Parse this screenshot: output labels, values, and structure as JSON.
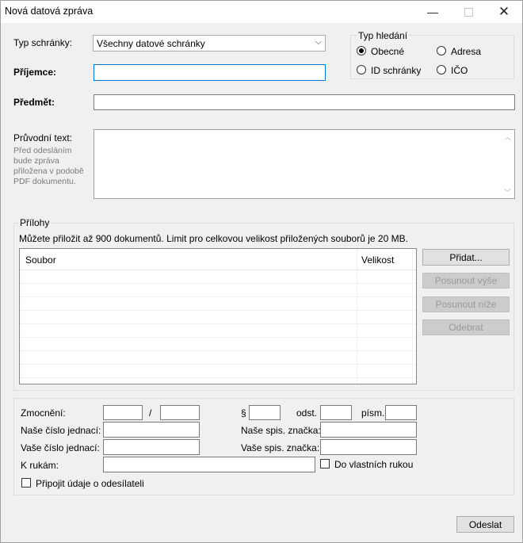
{
  "window": {
    "title": "Nová datová zpráva"
  },
  "form": {
    "typ_schranky_label": "Typ schránky:",
    "typ_schranky_value": "Všechny datové schránky",
    "prijemce_label": "Příjemce:",
    "prijemce_value": "",
    "predmet_label": "Předmět:",
    "predmet_value": "",
    "pruvodni_label": "Průvodní text:",
    "pruvodni_hint": "Před odesláním bude zpráva přiložena v podobě PDF dokumentu.",
    "pruvodni_value": ""
  },
  "search_type": {
    "title": "Typ hledání",
    "options": [
      {
        "label": "Obecné",
        "selected": true
      },
      {
        "label": "Adresa",
        "selected": false
      },
      {
        "label": "ID schránky",
        "selected": false
      },
      {
        "label": "IČO",
        "selected": false
      }
    ]
  },
  "attachments": {
    "title": "Přílohy",
    "info": "Můžete přiložit až 900 dokumentů. Limit pro celkovou velikost přiložených souborů je 20 MB.",
    "columns": [
      "Soubor",
      "Velikost"
    ],
    "rows": [],
    "buttons": {
      "add": "Přidat...",
      "up": "Posunout výše",
      "down": "Posunout níže",
      "remove": "Odebrat"
    }
  },
  "details": {
    "zmocneni_label": "Zmocnění:",
    "slash": "/",
    "paragraph": "§",
    "odst": "odst.",
    "pism": "písm.",
    "nase_cj_label": "Naše číslo jednací:",
    "nase_sz_label": "Naše spis. značka:",
    "vase_cj_label": "Vaše číslo jednací:",
    "vase_sz_label": "Vaše spis. značka:",
    "k_rukam_label": "K rukám:",
    "do_vlastnich_label": "Do vlastních rukou",
    "pripojit_label": "Připojit údaje o odesílateli"
  },
  "footer": {
    "send": "Odeslat"
  }
}
